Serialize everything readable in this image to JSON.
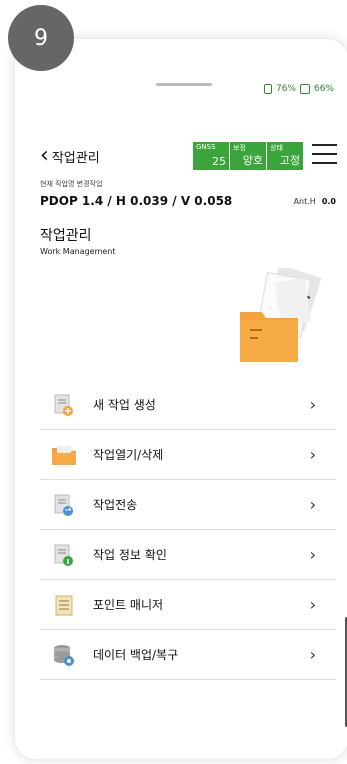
{
  "step_badge": "9",
  "status": {
    "gps_percent": "76%",
    "battery_percent": "66%"
  },
  "header": {
    "back_label": "작업관리"
  },
  "gnss": [
    {
      "label": "GNSS",
      "value": "25"
    },
    {
      "label": "보정",
      "value": "양호"
    },
    {
      "label": "상태",
      "value": "고정"
    }
  ],
  "caption": "현재 작업명  변경작업",
  "pdop_line": "PDOP 1.4 / H 0.039 / V 0.058",
  "antenna": {
    "label": "Ant.H",
    "value": "0.0"
  },
  "page": {
    "title": "작업관리",
    "subtitle": "Work Management"
  },
  "menu": [
    {
      "label": "새 작업 생성",
      "icon": "new-job-icon"
    },
    {
      "label": "작업열기/삭제",
      "icon": "folder-icon"
    },
    {
      "label": "작업전송",
      "icon": "transfer-icon"
    },
    {
      "label": "작업 정보 확인",
      "icon": "info-icon"
    },
    {
      "label": "포인트 매니저",
      "icon": "point-manager-icon"
    },
    {
      "label": "데이터 백업/복구",
      "icon": "database-icon"
    }
  ],
  "colors": {
    "accent_green": "#3aa53a",
    "folder_orange": "#f5a23a"
  }
}
